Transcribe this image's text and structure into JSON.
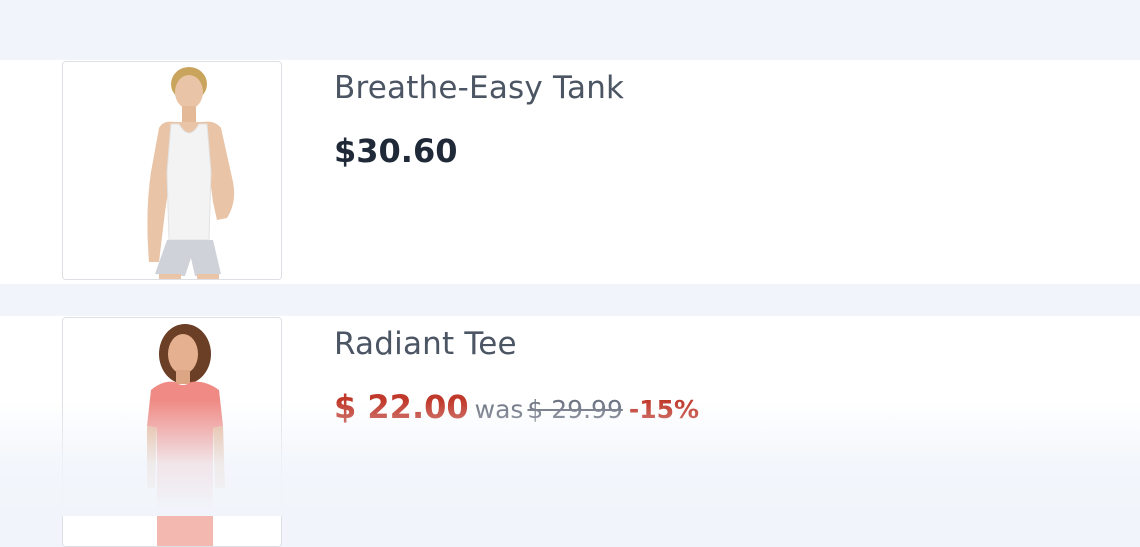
{
  "products": [
    {
      "name": "Breathe-Easy Tank",
      "price": "$30.60",
      "image_icon": "woman-white-tank-top-photo"
    },
    {
      "name": "Radiant Tee",
      "sale_price": "$ 22.00",
      "was_label": "was",
      "old_price": "$ 29.99",
      "discount": "-15%",
      "image_icon": "woman-pink-tee-photo"
    }
  ],
  "colors": {
    "page_background": "#f1f5fb",
    "card_background": "#ffffff",
    "name_text": "#4b5563",
    "price_text": "#1f2937",
    "sale_red": "#c0392b",
    "muted_text": "#6b7280"
  }
}
